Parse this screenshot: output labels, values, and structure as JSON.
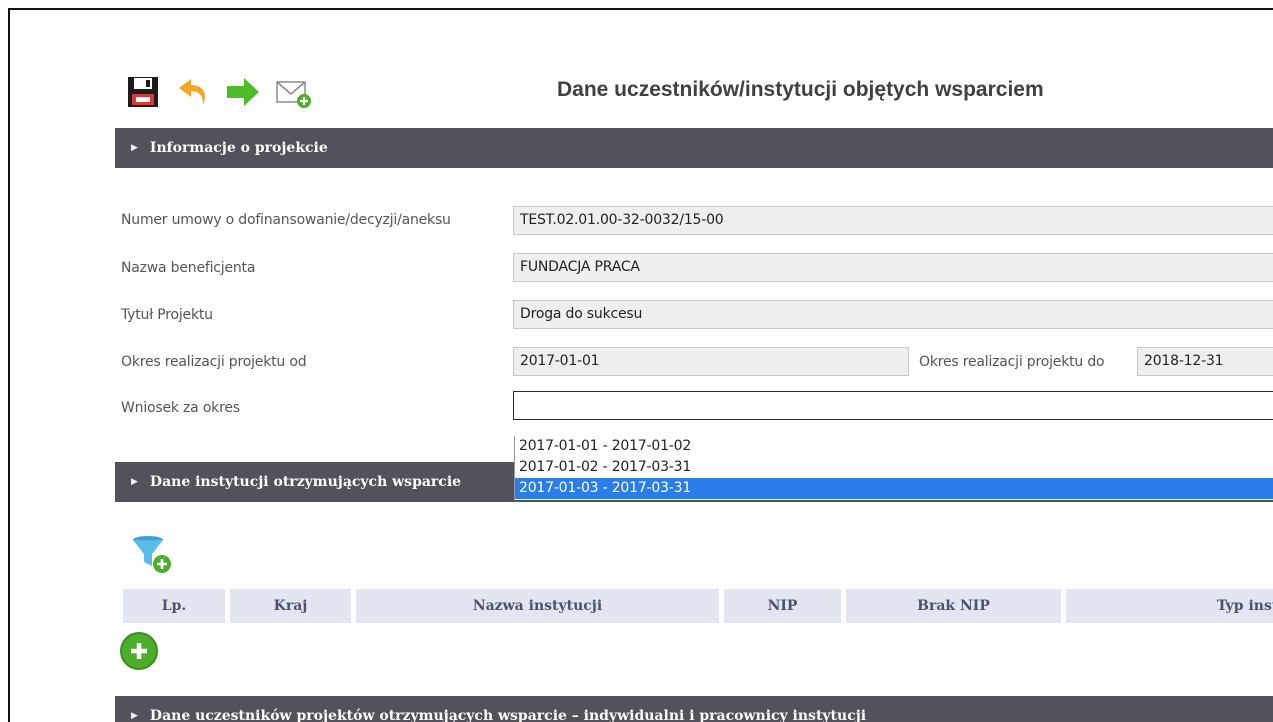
{
  "page": {
    "title": "Dane uczestników/instytucji objętych wsparciem"
  },
  "toolbar": {
    "icons": [
      "save-icon",
      "undo-icon",
      "forward-arrow-icon",
      "mail-add-icon"
    ]
  },
  "sections": {
    "project_info": "Informacje o projekcie",
    "institutions": "Dane instytucji otrzymujących wsparcie",
    "participants": "Dane uczestników projektów otrzymujących wsparcie – indywidualni i pracownicy instytucji"
  },
  "form": {
    "contract_label": "Numer umowy o dofinansowanie/decyzji/aneksu",
    "contract_value": "TEST.02.01.00-32-0032/15-00",
    "beneficiary_label": "Nazwa beneficjenta",
    "beneficiary_value": "FUNDACJA PRACA",
    "title_label": "Tytuł Projektu",
    "title_value": "Droga do sukcesu",
    "period_from_label": "Okres realizacji projektu od",
    "period_from_value": "2017-01-01",
    "period_to_label": "Okres realizacji projektu do",
    "period_to_value": "2018-12-31",
    "application_label": "Wniosek za okres",
    "application_value": ""
  },
  "dropdown": {
    "options": [
      "2017-01-01 - 2017-01-02",
      "2017-01-02 - 2017-03-31",
      "2017-01-03 - 2017-03-31"
    ],
    "selected_index": 2
  },
  "table": {
    "columns": [
      "Lp.",
      "Kraj",
      "Nazwa instytucji",
      "NIP",
      "Brak NIP",
      "Typ instytucji"
    ]
  },
  "colors": {
    "section_bar": "#52525c",
    "table_header_bg": "#e3e6f1",
    "selected_option": "#2b7de9",
    "add_button": "#4dae2c"
  }
}
